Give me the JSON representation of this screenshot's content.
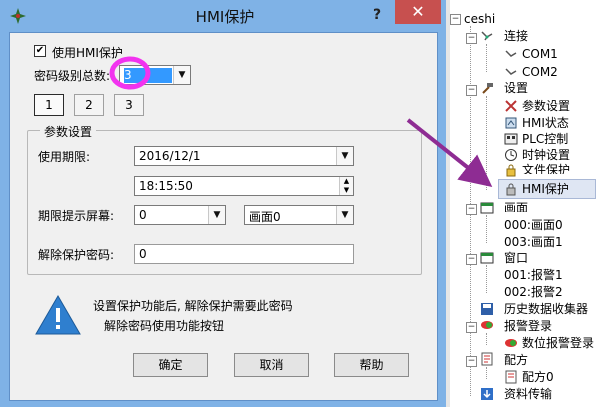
{
  "dialog": {
    "title": "HMI保护",
    "help_glyph": "?",
    "close_glyph": "✕",
    "enable_checkbox_label": "使用HMI保护",
    "enable_checked": true,
    "levels_label": "密码级别总数:",
    "levels_value": "3",
    "level_tabs": [
      "1",
      "2",
      "3"
    ],
    "group_title": "参数设置",
    "expiry_label": "使用期限:",
    "expiry_date": "2016/12/1",
    "expiry_time": "18:15:50",
    "screen_label": "期限提示屏幕:",
    "screen_value": "0",
    "screen_type": "画面0",
    "unlock_label": "解除保护密码:",
    "unlock_value": "0",
    "info_line1": "设置保护功能后, 解除保护需要此密码",
    "info_line2": "解除密码使用功能按钮",
    "ok_label": "确定",
    "cancel_label": "取消",
    "help_label": "帮助"
  },
  "tree": {
    "root": "ceshi",
    "connection": "连接",
    "com1": "COM1",
    "com2": "COM2",
    "settings": "设置",
    "param_settings": "参数设置",
    "hmi_status": "HMI状态",
    "plc_control": "PLC控制",
    "clock_settings": "时钟设置",
    "file_protect": "文件保护",
    "hmi_protect": "HMI保护",
    "screens": "画面",
    "screen0": "000:画面0",
    "screen1": "003:画面1",
    "windows": "窗口",
    "alarm1": "001:报警1",
    "alarm2": "002:报警2",
    "history": "历史数据收集器",
    "alarm_login": "报警登录",
    "bit_alarm_login": "数位报警登录",
    "recipe": "配方",
    "recipe0": "配方0",
    "transfer": "资料传输"
  },
  "colors": {
    "titlebar": "#7fb2e6",
    "close": "#c7504f",
    "annotation": "#8e2c93",
    "highlight_circle": "#f233ef",
    "selection": "#3399ff"
  }
}
